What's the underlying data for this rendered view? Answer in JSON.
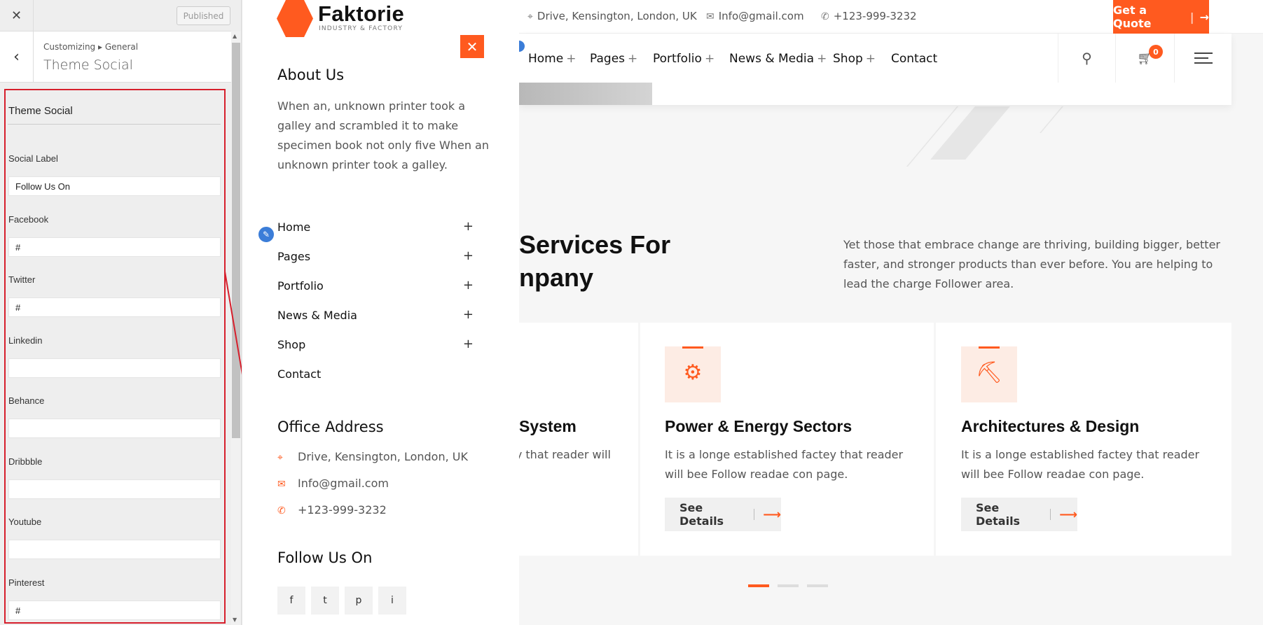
{
  "customizer": {
    "close_icon": "close-icon",
    "published_label": "Published",
    "breadcrumb": "Customizing ▸ General",
    "title": "Theme Social",
    "section_title": "Theme Social",
    "fields": [
      {
        "label": "Social Label",
        "value": "Follow Us On"
      },
      {
        "label": "Facebook",
        "value": "#"
      },
      {
        "label": "Twitter",
        "value": "#"
      },
      {
        "label": "Linkedin",
        "value": ""
      },
      {
        "label": "Behance",
        "value": ""
      },
      {
        "label": "Dribbble",
        "value": ""
      },
      {
        "label": "Youtube",
        "value": ""
      },
      {
        "label": "Pinterest",
        "value": "#"
      }
    ]
  },
  "offcanvas": {
    "logo_name": "Faktorie",
    "logo_tagline": "INDUSTRY & FACTORY",
    "about_title": "About Us",
    "about_text": "When an, unknown printer took a galley and scrambled it to make specimen book not only five When an unknown printer took a galley.",
    "menu": [
      "Home",
      "Pages",
      "Portfolio",
      "News & Media",
      "Shop",
      "Contact"
    ],
    "office_title": "Office Address",
    "address": "Drive, Kensington, London, UK",
    "email": "Info@gmail.com",
    "phone": "+123-999-3232",
    "follow_title": "Follow Us On",
    "social": [
      "f",
      "t",
      "p",
      "i"
    ]
  },
  "site": {
    "top": {
      "address": "Drive, Kensington, London, UK",
      "email": "Info@gmail.com",
      "phone": "+123-999-3232",
      "quote_label": "Get a Quote",
      "quote_arrow": "→"
    },
    "nav": [
      "Home",
      "Pages",
      "Portfolio",
      "News & Media",
      "Shop",
      "Contact"
    ],
    "nav_plus": "+",
    "cart_count": "0",
    "heading_line1": "Services For",
    "heading_line2": "npany",
    "description": "Yet those that embrace change are thriving, building bigger, better faster, and stronger products than ever before. You are helping to lead the charge Follower area.",
    "cards": [
      {
        "title": "System",
        "text": "ey that reader will",
        "button": ""
      },
      {
        "title": "Power & Energy Sectors",
        "text": "It is a longe established factey that reader will bee Follow readae con page.",
        "button": "See Details"
      },
      {
        "title": "Architectures & Design",
        "text": "It is a longe established factey that reader will bee Follow readae con page.",
        "button": "See Details"
      }
    ],
    "accent_color": "#ff5a1f"
  }
}
